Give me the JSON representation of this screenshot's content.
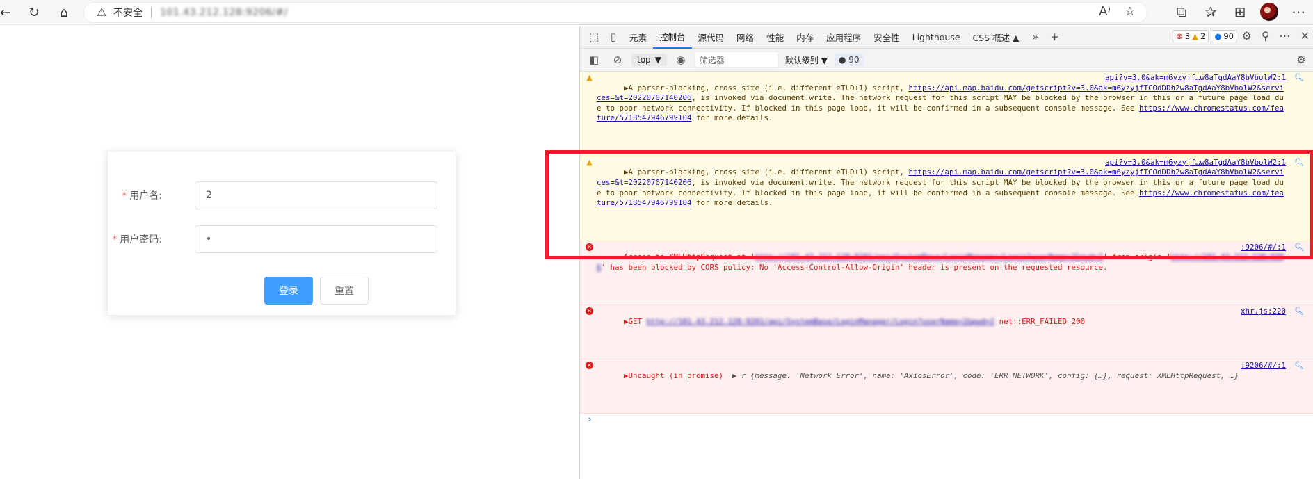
{
  "browser": {
    "insecure_label": "不安全",
    "url": "101.43.212.128:9206/#/",
    "read_aloud_label": "A⁾"
  },
  "login": {
    "username_label": "用户名:",
    "username_value": "2",
    "password_label": "用户密码:",
    "password_value": "•",
    "login_button": "登录",
    "reset_button": "重置",
    "required_mark": "*"
  },
  "devtools": {
    "tabs": [
      "元素",
      "控制台",
      "源代码",
      "网络",
      "性能",
      "内存",
      "应用程序",
      "安全性",
      "Lighthouse",
      "CSS 概述 ▲"
    ],
    "error_count": "3",
    "warning_count": "2",
    "info_count": "90",
    "context": "top",
    "filter_placeholder": "筛选器",
    "level": "默认级别",
    "message_count": "90"
  },
  "console": {
    "warn1": {
      "text_a": "▶A parser-blocking, cross site (i.e. different eTLD+1) script, ",
      "link": "https://api.map.baidu.com/getscript?v=3.0&ak=m6yzyjfTCOdDDh2w8aTgdAaY8bVbolW2&services=&t=20220707140206",
      "text_b": ", is invoked via document.write. The network request for this script MAY be blocked by the browser in this or a future page load due to poor network connectivity. If blocked in this page load, it will be confirmed in a subsequent console message. See ",
      "see_link": "https://www.chromestatus.com/feature/5718547946799104",
      "text_c": " for more details.",
      "source": "api?v=3.0&ak=m6yzyjf…w8aTgdAaY8bVbolW2:1"
    },
    "warn2": {
      "text_a": "▶A parser-blocking, cross site (i.e. different eTLD+1) script, ",
      "link": "https://api.map.baidu.com/getscript?v=3.0&ak=m6yzyjfTCOdDDh2w8aTgdAaY8bVbolW2&services=&t=20220707140206",
      "text_b": ", is invoked via document.write. The network request for this script MAY be blocked by the browser in this or a future page load due to poor network connectivity. If blocked in this page load, it will be confirmed in a subsequent console message. See ",
      "see_link": "https://www.chromestatus.com/feature/5718547946799104",
      "text_c": " for more details.",
      "source": "api?v=3.0&ak=m6yzyjf…w8aTgdAaY8bVbolW2:1"
    },
    "err1": {
      "text_a": "Access to XMLHttpRequest at '",
      "link": "http://101.43.212.128:9201/api/SystemBase/LoginManager/Login?userName=2&pwd=2",
      "text_b": "' from origin '",
      "origin_link": "http://101.43.212.128:9206",
      "text_c": "' has been blocked by CORS policy: No 'Access-Control-Allow-Origin' header is present on the requested resource.",
      "source": ":9206/#/:1"
    },
    "err2": {
      "text_a": "▶GET ",
      "link": "http://101.43.212.128:9201/api/SystemBase/LoginManager/Login?userName=2&pwd=2",
      "text_b": " net::ERR_FAILED 200",
      "source": "xhr.js:220"
    },
    "err3": {
      "text_a": "▶Uncaught (in promise)  ",
      "detail": "▶ r {message: 'Network Error', name: 'AxiosError', code: 'ERR_NETWORK', config: {…}, request: XMLHttpRequest, …}",
      "source": ":9206/#/:1"
    },
    "prompt": "›"
  },
  "colors": {
    "primary": "#409eff",
    "error": "#e01919",
    "highlight_box": "#e9212e"
  }
}
